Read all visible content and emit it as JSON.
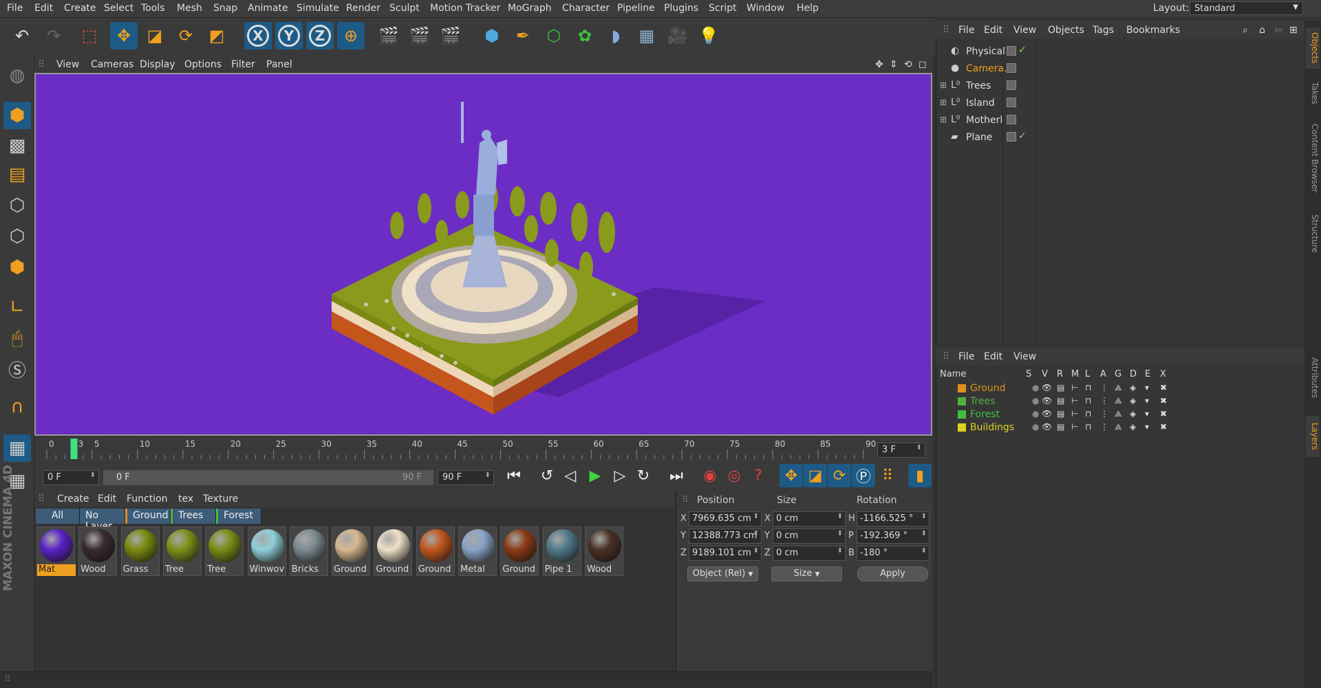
{
  "menubar": {
    "items": [
      "File",
      "Edit",
      "Create",
      "Select",
      "Tools",
      "Mesh",
      "Snap",
      "Animate",
      "Simulate",
      "Render",
      "Sculpt",
      "Motion Tracker",
      "MoGraph",
      "Character",
      "Pipeline",
      "Plugins",
      "Script",
      "Window",
      "Help"
    ],
    "layout_label": "Layout:",
    "layout_value": "Standard"
  },
  "toolbar": {
    "axis_x": "X",
    "axis_y": "Y",
    "axis_z": "Z"
  },
  "viewport": {
    "menu": [
      "View",
      "Cameras",
      "Display",
      "Options",
      "Filter",
      "Panel"
    ],
    "background": "#6b2dc4"
  },
  "timeline": {
    "ticks": [
      "0",
      "5",
      "10",
      "15",
      "20",
      "25",
      "30",
      "35",
      "40",
      "45",
      "50",
      "55",
      "60",
      "65",
      "70",
      "75",
      "80",
      "85",
      "90"
    ],
    "playhead_label": "3",
    "playhead_frame": 3,
    "current_frame": "3 F"
  },
  "transport": {
    "start_field": "0 F",
    "range_start": "0 F",
    "range_end": "90 F",
    "end_field": "90 F"
  },
  "material_manager": {
    "menu": [
      "Create",
      "Edit",
      "Function",
      "tex",
      "Texture"
    ],
    "filters": [
      "All",
      "No Layer",
      "Ground",
      "Trees",
      "Forest"
    ],
    "materials": [
      {
        "name": "Mat",
        "color": "#5a22c8",
        "selected": true
      },
      {
        "name": "Wood",
        "color": "#3a2a30"
      },
      {
        "name": "Grass",
        "color": "#7a8a10"
      },
      {
        "name": "Tree",
        "color": "#7f9018"
      },
      {
        "name": "Tree",
        "color": "#7a8c14"
      },
      {
        "name": "Winwov",
        "color": "#8fd0d8"
      },
      {
        "name": "Bricks",
        "color": "#7c8a90"
      },
      {
        "name": "Ground",
        "color": "#d8b890"
      },
      {
        "name": "Ground",
        "color": "#efe0c8"
      },
      {
        "name": "Ground",
        "color": "#c4561c"
      },
      {
        "name": "Metal",
        "color": "#8aa4c8"
      },
      {
        "name": "Ground",
        "color": "#8c3a14"
      },
      {
        "name": "Pipe 1",
        "color": "#507a8a"
      },
      {
        "name": "Wood",
        "color": "#4a3024"
      }
    ]
  },
  "coordinates": {
    "headers": {
      "position": "Position",
      "size": "Size",
      "rotation": "Rotation"
    },
    "rows": [
      {
        "axis": "X",
        "position": "7969.635 cm",
        "size_axis": "X",
        "size": "0 cm",
        "rot_axis": "H",
        "rotation": "-1166.525 °"
      },
      {
        "axis": "Y",
        "position": "12388.773 cm",
        "size_axis": "Y",
        "size": "0 cm",
        "rot_axis": "P",
        "rotation": "-192.369 °"
      },
      {
        "axis": "Z",
        "position": "9189.101 cm",
        "size_axis": "Z",
        "size": "0 cm",
        "rot_axis": "B",
        "rotation": "-180 °"
      }
    ],
    "mode": "Object (Rel)",
    "size_mode": "Size",
    "apply": "Apply"
  },
  "object_manager": {
    "menu": [
      "File",
      "Edit",
      "View",
      "Objects",
      "Tags",
      "Bookmarks"
    ],
    "objects": [
      {
        "name": "Physical",
        "icon": "sky-icon",
        "selected": false
      },
      {
        "name": "Camera.",
        "icon": "camera-icon",
        "selected": true
      },
      {
        "name": "Trees",
        "icon": "null-icon",
        "selected": false
      },
      {
        "name": "Island",
        "icon": "null-icon",
        "selected": false
      },
      {
        "name": "Motherl",
        "icon": "null-icon",
        "selected": false
      },
      {
        "name": "Plane",
        "icon": "plane-icon",
        "selected": false
      }
    ]
  },
  "layer_manager": {
    "menu": [
      "File",
      "Edit",
      "View"
    ],
    "columns": [
      "Name",
      "S",
      "V",
      "R",
      "M",
      "L",
      "A",
      "G",
      "D",
      "E",
      "X"
    ],
    "layers": [
      {
        "name": "Ground",
        "color": "#e0901c"
      },
      {
        "name": "Trees",
        "color": "#50b040"
      },
      {
        "name": "Forest",
        "color": "#40c040"
      },
      {
        "name": "Buildings",
        "color": "#e0d020"
      }
    ]
  },
  "side_tabs": [
    "Objects",
    "Takes",
    "Content Browser",
    "Structure",
    "Attributes",
    "Layers"
  ],
  "branding": "MAXON CINEMA 4D"
}
